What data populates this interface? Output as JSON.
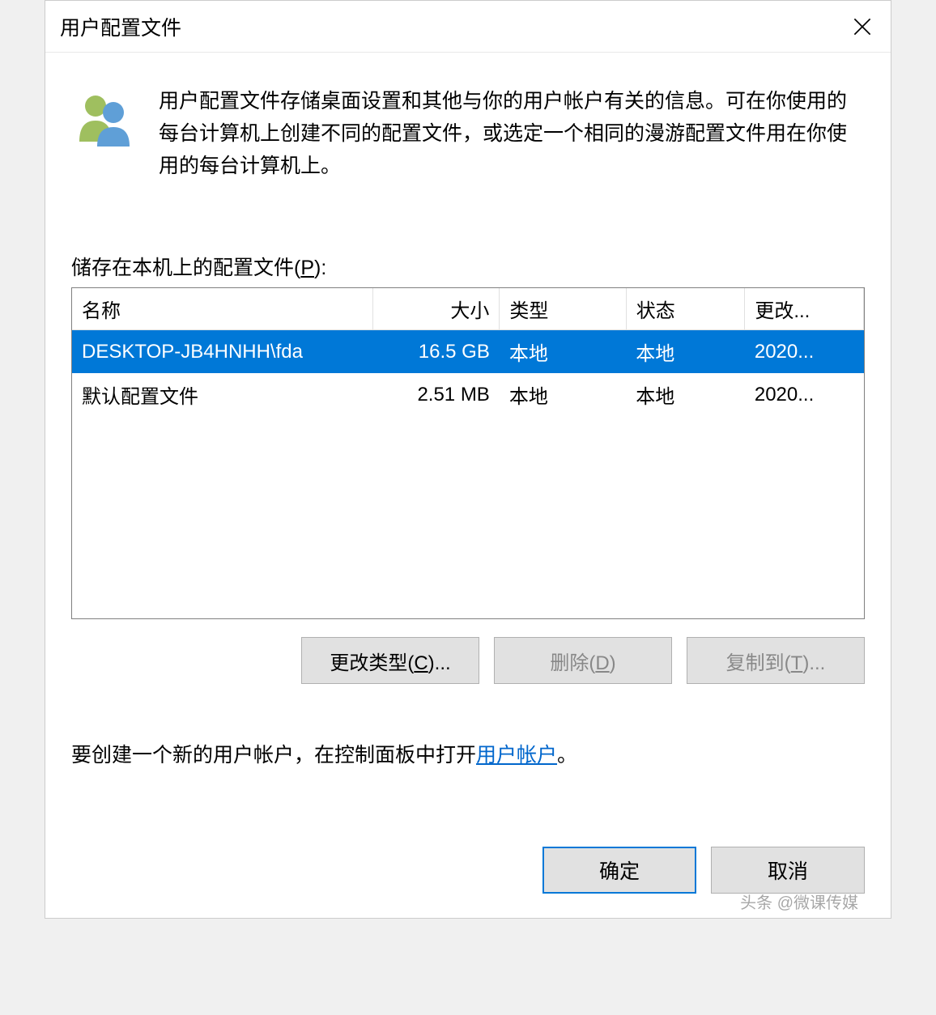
{
  "window": {
    "title": "用户配置文件"
  },
  "description": "用户配置文件存储桌面设置和其他与你的用户帐户有关的信息。可在你使用的每台计算机上创建不同的配置文件，或选定一个相同的漫游配置文件用在你使用的每台计算机上。",
  "table": {
    "label_prefix": "储存在本机上的配置文件(",
    "label_key": "P",
    "label_suffix": "):",
    "headers": {
      "name": "名称",
      "size": "大小",
      "type": "类型",
      "status": "状态",
      "modified": "更改..."
    },
    "rows": [
      {
        "name": "DESKTOP-JB4HNHH\\fda",
        "size": "16.5 GB",
        "type": "本地",
        "status": "本地",
        "modified": "2020...",
        "selected": true
      },
      {
        "name": "默认配置文件",
        "size": "2.51 MB",
        "type": "本地",
        "status": "本地",
        "modified": "2020...",
        "selected": false
      }
    ]
  },
  "actions": {
    "change_type_prefix": "更改类型(",
    "change_type_key": "C",
    "change_type_suffix": ")...",
    "delete_prefix": "删除(",
    "delete_key": "D",
    "delete_suffix": ")",
    "copy_to_prefix": "复制到(",
    "copy_to_key": "T",
    "copy_to_suffix": ")..."
  },
  "create_note": {
    "prefix": "要创建一个新的用户帐户，在控制面板中打开",
    "link": "用户帐户",
    "suffix": "。"
  },
  "dialog_buttons": {
    "ok": "确定",
    "cancel": "取消"
  },
  "watermark": "头条 @微课传媒"
}
